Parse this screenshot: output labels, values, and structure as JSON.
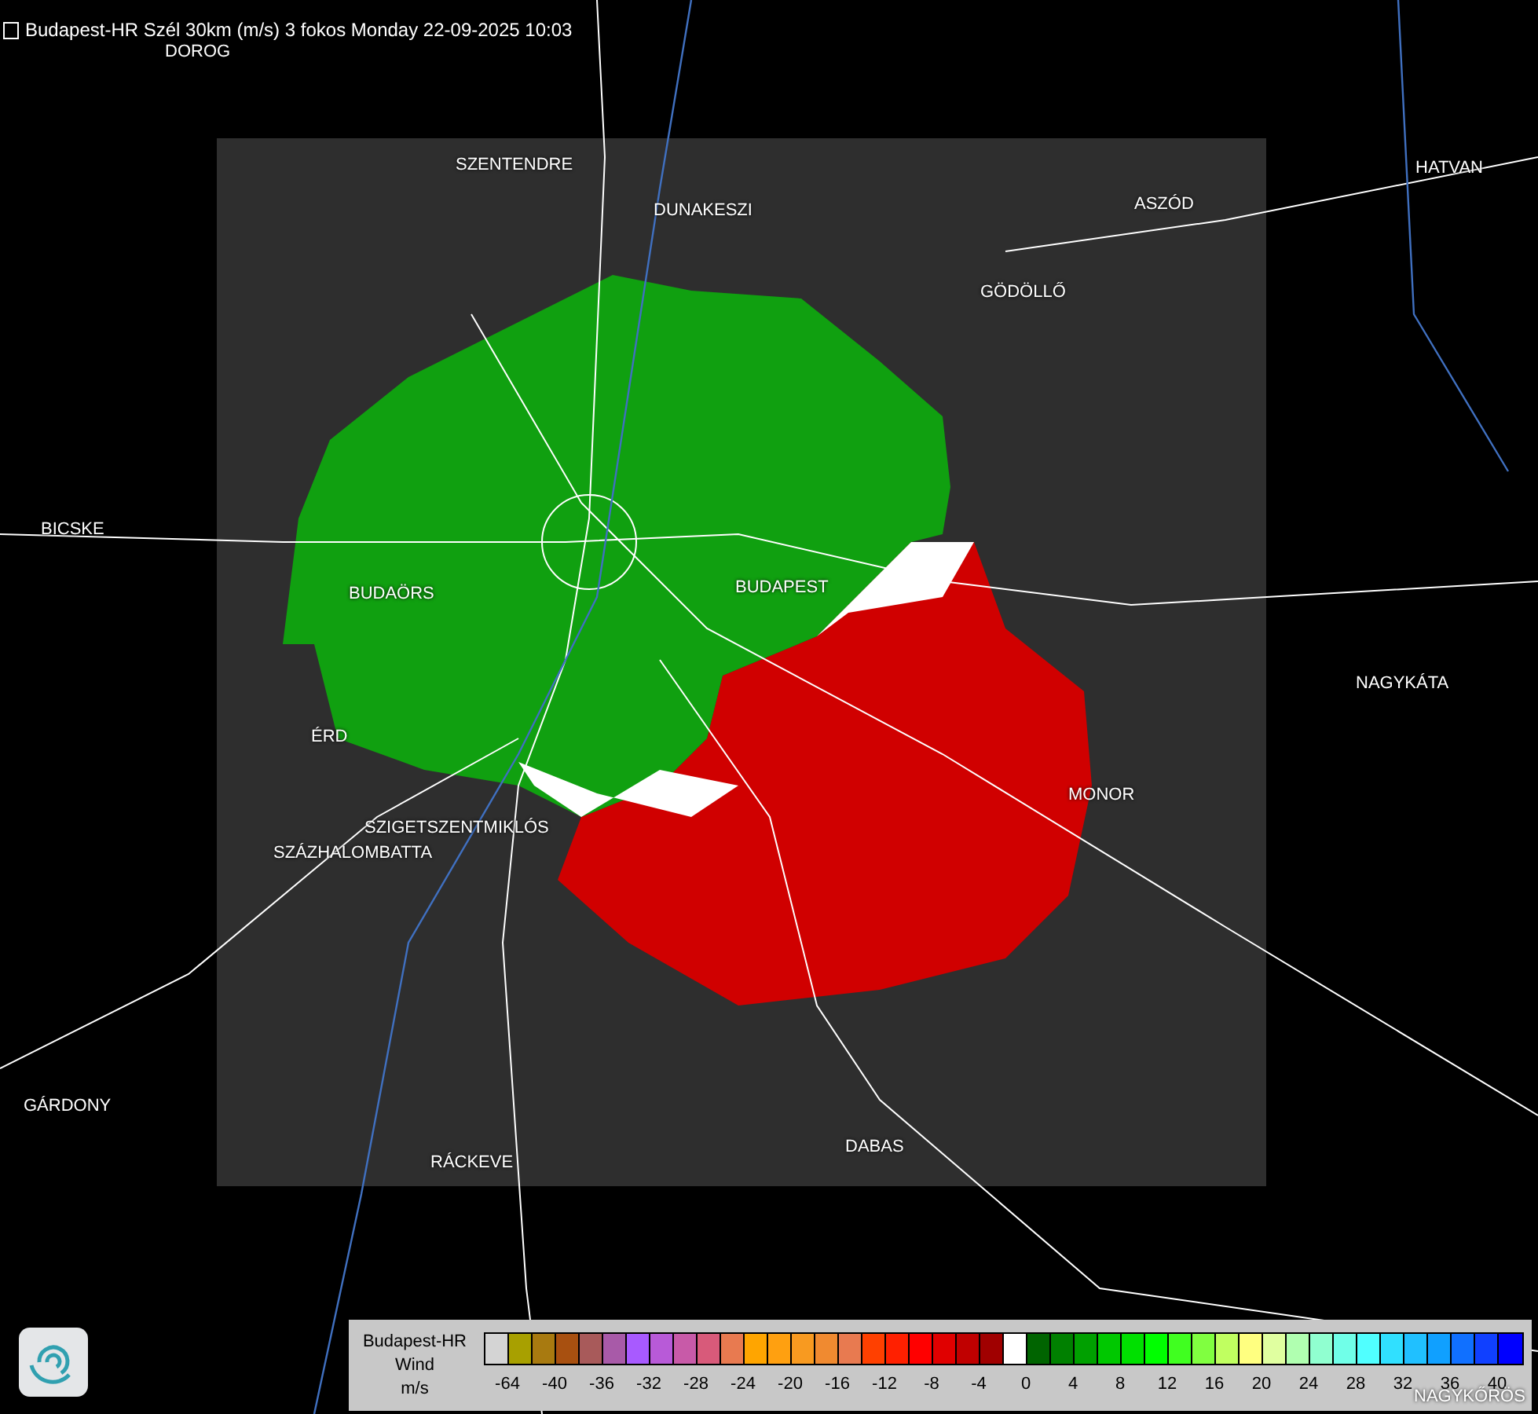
{
  "title": "Budapest-HR Szél 30km (m/s) 3 fokos Monday 22-09-2025 10:03",
  "places": [
    "DOROG",
    "SZENTENDRE",
    "DUNAKESZI",
    "HATVAN",
    "ASZÓD",
    "GÖDÖLLŐ",
    "BICSKE",
    "BUDAÖRS",
    "BUDAPEST",
    "NAGYKÁTA",
    "ÉRD",
    "MONOR",
    "SZIGETSZENTMIKLÓS",
    "SZÁZHALOMBATTA",
    "GÁRDONY",
    "RÁCKEVE",
    "DABAS",
    "NAGYKŐRÖS"
  ],
  "legend": {
    "label_lines": [
      "Budapest-HR",
      "Wind",
      "m/s"
    ],
    "swatches": [
      {
        "color": "#d4d4d4"
      },
      {
        "color": "#a8a000"
      },
      {
        "color": "#a87a10"
      },
      {
        "color": "#a85010"
      },
      {
        "color": "#a85a5a"
      },
      {
        "color": "#a85aa8"
      },
      {
        "color": "#a85aff"
      },
      {
        "color": "#b85ad8"
      },
      {
        "color": "#c85aa8"
      },
      {
        "color": "#d85a7a"
      },
      {
        "color": "#e87a50"
      },
      {
        "color": "#ffa500"
      },
      {
        "color": "#ffa010"
      },
      {
        "color": "#f89a20"
      },
      {
        "color": "#f08a30"
      },
      {
        "color": "#e87a50"
      },
      {
        "color": "#ff4000"
      },
      {
        "color": "#ff2000"
      },
      {
        "color": "#ff0000"
      },
      {
        "color": "#e00000"
      },
      {
        "color": "#c00000"
      },
      {
        "color": "#a00000"
      },
      {
        "color": "#ffffff"
      },
      {
        "color": "#006400"
      },
      {
        "color": "#008000"
      },
      {
        "color": "#00a000"
      },
      {
        "color": "#00c800"
      },
      {
        "color": "#00e000"
      },
      {
        "color": "#00ff00"
      },
      {
        "color": "#40ff20"
      },
      {
        "color": "#80ff40"
      },
      {
        "color": "#c0ff60"
      },
      {
        "color": "#ffff80"
      },
      {
        "color": "#e0ffa0"
      },
      {
        "color": "#b0ffb0"
      },
      {
        "color": "#90ffd0"
      },
      {
        "color": "#70ffe8"
      },
      {
        "color": "#50ffff"
      },
      {
        "color": "#30e0ff"
      },
      {
        "color": "#20c0ff"
      },
      {
        "color": "#10a0ff"
      },
      {
        "color": "#1070ff"
      },
      {
        "color": "#1040ff"
      },
      {
        "color": "#0000ff"
      }
    ],
    "ticks": [
      "-64",
      "-40",
      "-36",
      "-32",
      "-28",
      "-24",
      "-20",
      "-16",
      "-12",
      "-8",
      "-4",
      "0",
      "4",
      "8",
      "12",
      "16",
      "20",
      "24",
      "28",
      "32",
      "36",
      "40"
    ]
  }
}
